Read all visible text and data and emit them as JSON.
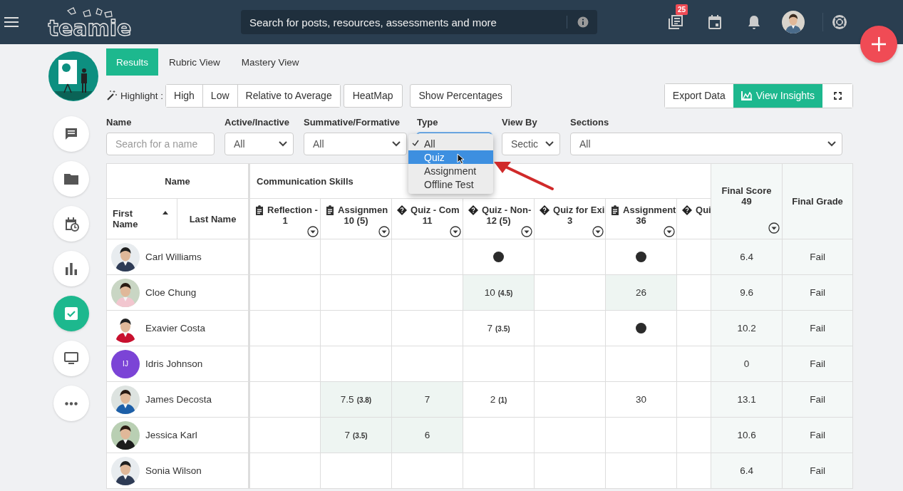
{
  "topbar": {
    "logo": "teamie",
    "search": {
      "placeholder": "Search for posts, resources, assessments and more"
    },
    "badge": "25"
  },
  "sidebar": {
    "items": [
      {
        "kind": "chat",
        "selected": false
      },
      {
        "kind": "folder",
        "selected": false
      },
      {
        "kind": "schedule",
        "selected": false
      },
      {
        "kind": "chart",
        "selected": false
      },
      {
        "kind": "check",
        "selected": true
      },
      {
        "kind": "monitor",
        "selected": false
      },
      {
        "kind": "more",
        "selected": false
      }
    ]
  },
  "tabs": [
    {
      "label": "Results",
      "selected": true
    },
    {
      "label": "Rubric View",
      "selected": false
    },
    {
      "label": "Mastery View",
      "selected": false
    }
  ],
  "toolbar": {
    "highlight_label": "Highlight :",
    "highlight_options": [
      "High",
      "Low",
      "Relative to Average"
    ],
    "buttons": [
      "HeatMap",
      "Show Percentages"
    ],
    "actions": [
      {
        "label": "Export Data",
        "primary": false
      },
      {
        "label": "View Insights",
        "primary": true
      }
    ]
  },
  "filters": [
    {
      "label": "Name",
      "kind": "text",
      "placeholder": "Search for a name",
      "focused": false
    },
    {
      "label": "Active/Inactive",
      "kind": "select",
      "value": "All",
      "focused": false
    },
    {
      "label": "Summative/Formative",
      "kind": "select",
      "value": "All",
      "focused": false
    },
    {
      "label": "Type",
      "kind": "select",
      "focused": true
    },
    {
      "label": "View By",
      "kind": "select",
      "value": "Sectic",
      "focused": false
    },
    {
      "label": "Sections",
      "kind": "select",
      "value": "All",
      "focused": false
    }
  ],
  "type_menu": {
    "options": [
      {
        "label": "All",
        "checked": true,
        "selected": false
      },
      {
        "label": "Quiz",
        "checked": false,
        "selected": true
      },
      {
        "label": "Assignment",
        "checked": false,
        "selected": false
      },
      {
        "label": "Offline Test",
        "checked": false,
        "selected": false
      }
    ]
  },
  "table": {
    "group_headers": [
      "Name",
      "Communication Skills"
    ],
    "name_columns": [
      {
        "label": "First Name",
        "sorted": true
      },
      {
        "label": "Last Name",
        "sorted": false
      }
    ],
    "assessments": [
      {
        "kind": "clipboard",
        "title": "Reflection -",
        "number": "1"
      },
      {
        "kind": "clipboard",
        "title": "Assignmen",
        "number": "10 (5)"
      },
      {
        "kind": "quiz",
        "title": "Quiz - Com",
        "number": "11"
      },
      {
        "kind": "quiz",
        "title": "Quiz - Non-",
        "number": "12 (5)"
      },
      {
        "kind": "quiz",
        "title": "Quiz for Exi",
        "number": "3"
      },
      {
        "kind": "clipboard",
        "title": "Assignment",
        "number": "36"
      },
      {
        "kind": "quiz",
        "title": "Qui"
      }
    ],
    "final_score": {
      "label": "Final Score",
      "value": "49"
    },
    "final_grade": "Final Grade",
    "rows": [
      {
        "name": "Carl Williams",
        "final_score": "6.4",
        "grade": "Fail",
        "cells": [
          {
            "kind": "empty"
          },
          {
            "kind": "empty"
          },
          {
            "kind": "empty"
          },
          {
            "kind": "dot"
          },
          {
            "kind": "empty"
          },
          {
            "kind": "dot"
          },
          {
            "kind": "empty"
          }
        ]
      },
      {
        "name": "Cloe Chung",
        "final_score": "9.6",
        "grade": "Fail",
        "cells": [
          {
            "kind": "empty"
          },
          {
            "kind": "empty"
          },
          {
            "kind": "empty"
          },
          {
            "kind": "score",
            "value": "10",
            "extra": "(4.5)",
            "shaded": true
          },
          {
            "kind": "empty"
          },
          {
            "kind": "score",
            "value": "26",
            "shaded": true
          },
          {
            "kind": "empty"
          }
        ]
      },
      {
        "name": "Exavier Costa",
        "final_score": "10.2",
        "grade": "Fail",
        "cells": [
          {
            "kind": "empty"
          },
          {
            "kind": "empty"
          },
          {
            "kind": "empty"
          },
          {
            "kind": "score",
            "value": "7",
            "extra": "(3.5)",
            "shaded": false
          },
          {
            "kind": "empty"
          },
          {
            "kind": "dot"
          },
          {
            "kind": "empty"
          }
        ]
      },
      {
        "name": "Idris Johnson",
        "avatar": {
          "kind": "initials",
          "initials": "IJ"
        },
        "final_score": "0",
        "grade": "Fail",
        "cells": [
          {
            "kind": "empty"
          },
          {
            "kind": "empty"
          },
          {
            "kind": "empty"
          },
          {
            "kind": "empty"
          },
          {
            "kind": "empty"
          },
          {
            "kind": "empty"
          },
          {
            "kind": "empty"
          }
        ]
      },
      {
        "name": "James Decosta",
        "final_score": "13.1",
        "grade": "Fail",
        "cells": [
          {
            "kind": "empty"
          },
          {
            "kind": "score",
            "value": "7.5",
            "extra": "(3.8)",
            "shaded": true
          },
          {
            "kind": "score",
            "value": "7",
            "shaded": true
          },
          {
            "kind": "score",
            "value": "2",
            "extra": "(1)",
            "shaded": false
          },
          {
            "kind": "empty"
          },
          {
            "kind": "score",
            "value": "30",
            "shaded": false
          },
          {
            "kind": "empty"
          }
        ]
      },
      {
        "name": "Jessica Karl",
        "final_score": "10.6",
        "grade": "Fail",
        "cells": [
          {
            "kind": "empty"
          },
          {
            "kind": "score",
            "value": "7",
            "extra": "(3.5)",
            "shaded": true
          },
          {
            "kind": "score",
            "value": "6",
            "shaded": true
          },
          {
            "kind": "empty"
          },
          {
            "kind": "empty"
          },
          {
            "kind": "empty"
          },
          {
            "kind": "empty"
          }
        ]
      },
      {
        "name": "Sonia Wilson",
        "final_score": "6.4",
        "grade": "Fail",
        "cells": [
          {
            "kind": "empty"
          },
          {
            "kind": "empty"
          },
          {
            "kind": "empty"
          },
          {
            "kind": "empty"
          },
          {
            "kind": "empty"
          },
          {
            "kind": "empty"
          },
          {
            "kind": "empty"
          }
        ]
      }
    ]
  }
}
